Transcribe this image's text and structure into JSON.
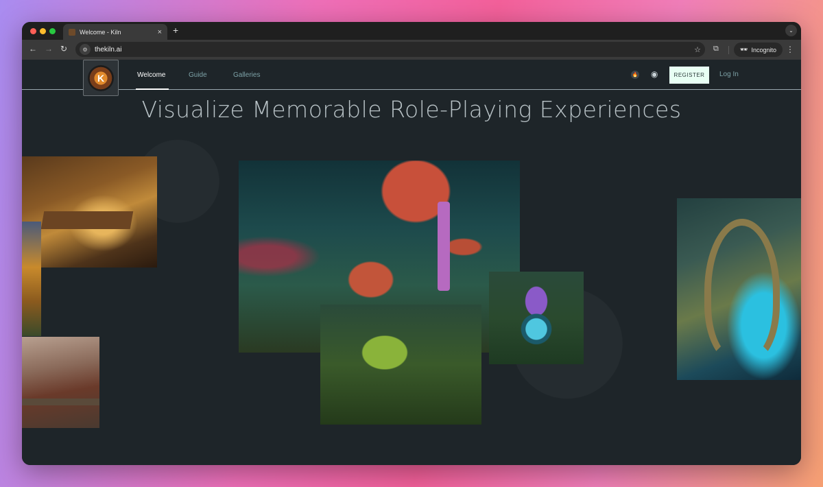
{
  "browser": {
    "tab_title": "Welcome - Kiln",
    "tab_close": "×",
    "new_tab": "+",
    "tab_menu_glyph": "⌄",
    "url": "thekiln.ai",
    "incognito_label": "Incognito",
    "icons": {
      "back": "←",
      "forward": "→",
      "reload": "↻",
      "site_info": "⚙",
      "bookmark": "☆",
      "extensions": "⧉",
      "incognito": "🕶",
      "menu": "⋮"
    },
    "traffic_colors": [
      "#ff5f57",
      "#febc2e",
      "#28c840"
    ]
  },
  "site": {
    "logo_text": "K",
    "nav": {
      "welcome": "Welcome",
      "guide": "Guide",
      "galleries": "Galleries"
    },
    "icons": {
      "fire": "🔥",
      "discord": "◉"
    },
    "register_label": "REGISTER",
    "login_label": "Log In"
  },
  "hero": {
    "title": "Visualize Memorable Role-Playing Experiences"
  }
}
